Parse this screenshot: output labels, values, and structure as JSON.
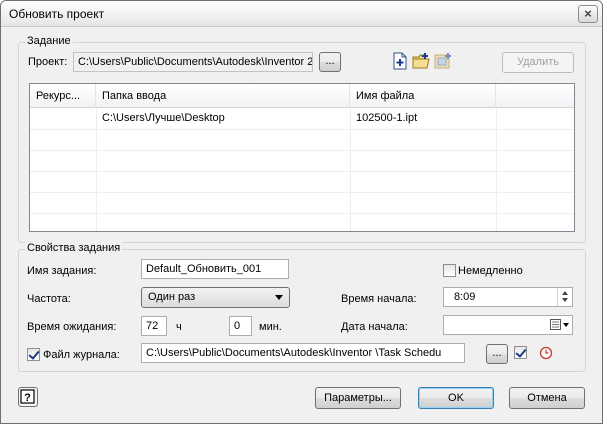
{
  "window": {
    "title": "Обновить проект",
    "close_glyph": "×"
  },
  "task_group": {
    "title": "Задание",
    "project_label": "Проект:",
    "project_value": "C:\\Users\\Public\\Documents\\Autodesk\\Inventor 2",
    "browse_label": "...",
    "delete_label": "Удалить",
    "toolbar_icons": [
      "add-file-icon",
      "add-folder-icon",
      "add-project-icon"
    ],
    "table": {
      "columns": [
        "Рекурс...",
        "Папка ввода",
        "Имя файла"
      ],
      "rows": [
        {
          "recursive": "",
          "input_folder": "C:\\Users\\Лучше\\Desktop",
          "file_name": "102500-1.ipt"
        }
      ]
    }
  },
  "props_group": {
    "title": "Свойства задания",
    "task_name_label": "Имя задания:",
    "task_name_value": "Default_Обновить_001",
    "immediately_label": "Немедленно",
    "immediately_checked": false,
    "frequency_label": "Частота:",
    "frequency_value": "Один раз",
    "start_time_label": "Время начала:",
    "start_time_value": "8:09",
    "wait_time_label": "Время ожидания:",
    "wait_hours_value": "72",
    "hours_unit": "ч",
    "wait_minutes_value": "0",
    "minutes_unit": "мин.",
    "start_date_label": "Дата начала:",
    "start_date_value": "",
    "log_file_label": "Файл журнала:",
    "log_file_checked": true,
    "log_file_value": "C:\\Users\\Public\\Documents\\Autodesk\\Inventor                \\Task Schedu",
    "log_browse_label": "...",
    "log_option_checked": true
  },
  "footer": {
    "help_icon": "help-icon",
    "options_label": "Параметры...",
    "ok_label": "OK",
    "cancel_label": "Отмена"
  }
}
